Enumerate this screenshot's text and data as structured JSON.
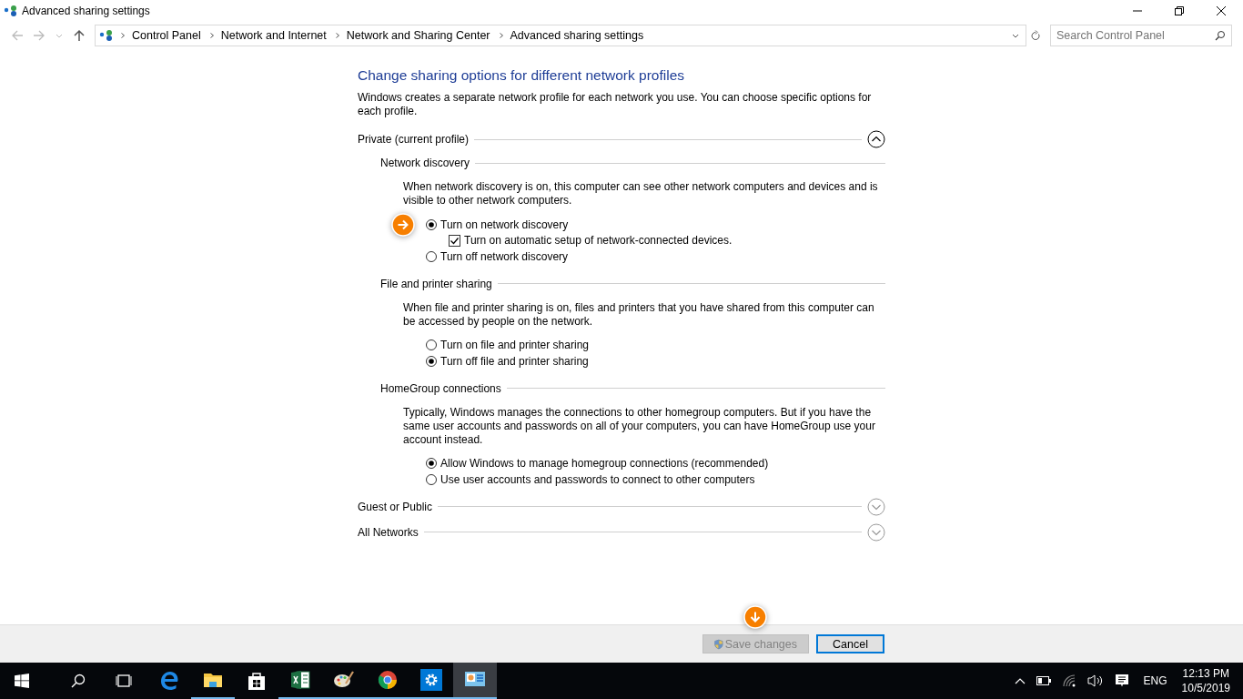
{
  "window": {
    "title": "Advanced sharing settings"
  },
  "address_bar": {
    "breadcrumbs": [
      "Control Panel",
      "Network and Internet",
      "Network and Sharing Center",
      "Advanced sharing settings"
    ],
    "search": {
      "placeholder": "Search Control Panel"
    }
  },
  "content": {
    "heading": "Change sharing options for different network profiles",
    "intro": "Windows creates a separate network profile for each network you use. You can choose specific options for each profile.",
    "profiles": [
      {
        "label": "Private (current profile)",
        "expanded": true,
        "sections": [
          {
            "title": "Network discovery",
            "description": "When network discovery is on, this computer can see other network computers and devices and is visible to other network computers.",
            "options": [
              {
                "label": "Turn on network discovery",
                "selected": true,
                "children": [
                  {
                    "label": "Turn on automatic setup of network-connected devices.",
                    "checked": true
                  }
                ]
              },
              {
                "label": "Turn off network discovery",
                "selected": false
              }
            ]
          },
          {
            "title": "File and printer sharing",
            "description": "When file and printer sharing is on, files and printers that you have shared from this computer can be accessed by people on the network.",
            "options": [
              {
                "label": "Turn on file and printer sharing",
                "selected": false
              },
              {
                "label": "Turn off file and printer sharing",
                "selected": true
              }
            ]
          },
          {
            "title": "HomeGroup connections",
            "description": "Typically, Windows manages the connections to other homegroup computers. But if you have the same user accounts and passwords on all of your computers, you can have HomeGroup use your account instead.",
            "options": [
              {
                "label": "Allow Windows to manage homegroup connections (recommended)",
                "selected": true
              },
              {
                "label": "Use user accounts and passwords to connect to other computers",
                "selected": false
              }
            ]
          }
        ]
      },
      {
        "label": "Guest or Public",
        "expanded": false
      },
      {
        "label": "All Networks",
        "expanded": false
      }
    ]
  },
  "footer": {
    "buttons": [
      {
        "label": "Save changes",
        "disabled": true,
        "kind": "save"
      },
      {
        "label": "Cancel",
        "disabled": false,
        "kind": "cancel"
      }
    ]
  },
  "taskbar": {
    "apps": [
      {
        "kind": "browser-e",
        "running": false,
        "selected": false
      },
      {
        "kind": "folder",
        "running": true,
        "selected": false
      },
      {
        "kind": "store",
        "running": false,
        "selected": false
      },
      {
        "kind": "spreadsheet",
        "running": true,
        "selected": false
      },
      {
        "kind": "paint",
        "running": true,
        "selected": false
      },
      {
        "kind": "browser-c",
        "running": true,
        "selected": false
      },
      {
        "kind": "settings",
        "running": true,
        "selected": false
      },
      {
        "kind": "control-panel",
        "running": true,
        "selected": true
      }
    ],
    "language": "ENG",
    "time": "12:13 PM",
    "date": "10/5/2019"
  }
}
